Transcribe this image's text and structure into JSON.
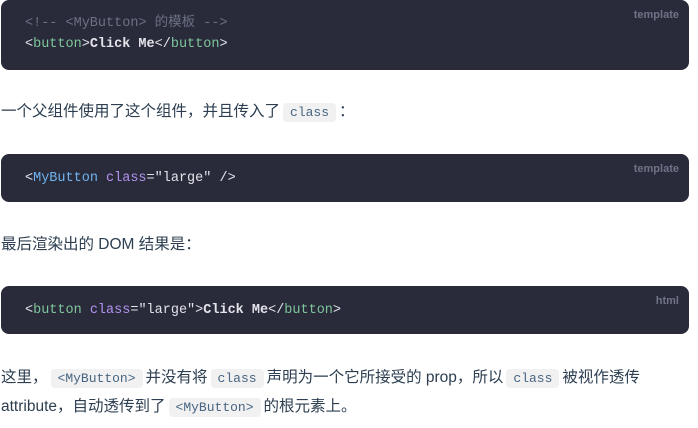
{
  "blocks": [
    {
      "lang": "template",
      "line1": {
        "comment": "<!-- <MyButton> 的模板 -->"
      },
      "line2": {
        "open_lt": "<",
        "tag": "button",
        "open_gt": ">",
        "text": "Click Me",
        "close_lt": "</",
        "close_tag": "button",
        "close_gt": ">"
      }
    },
    {
      "lang": "template",
      "line1": {
        "lt": "<",
        "component": "MyButton",
        "attr": "class",
        "eq": "=",
        "value": "\"large\"",
        "end": " />"
      }
    },
    {
      "lang": "html",
      "line1": {
        "lt": "<",
        "tag": "button",
        "attr": "class",
        "eq": "=",
        "value": "\"large\"",
        "gt": ">",
        "text": "Click Me",
        "close_lt": "</",
        "close_tag": "button",
        "close_gt": ">"
      }
    }
  ],
  "paragraphs": {
    "p1": {
      "before": "一个父组件使用了这个组件，并且传入了",
      "code": "class",
      "after": "："
    },
    "p2": {
      "text": "最后渲染出的 DOM 结果是："
    },
    "p3": {
      "t1": "这里，",
      "c1": "<MyButton>",
      "t2": "并没有将",
      "c2": "class",
      "t3": "声明为一个它所接受的 prop，所以",
      "c3": "class",
      "t4": "被视作透传 attribute，自动透传到了",
      "c4": "<MyButton>",
      "t5": "的根元素上。"
    }
  }
}
